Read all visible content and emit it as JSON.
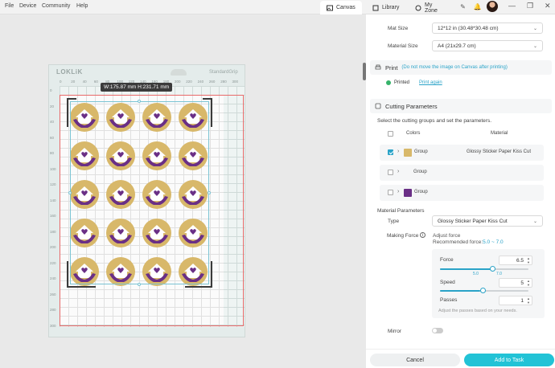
{
  "menu": {
    "file": "File",
    "device": "Device",
    "community": "Community",
    "help": "Help"
  },
  "tabs": {
    "canvas": "Canvas",
    "library": "Library",
    "myzone": "My Zone"
  },
  "mat": {
    "logo": "LOKLiK",
    "grip": "StandardGrip",
    "ruler_top": [
      "0",
      "20",
      "40",
      "60",
      "80",
      "100",
      "120",
      "140",
      "160",
      "180",
      "200",
      "220",
      "240",
      "260",
      "280",
      "300"
    ],
    "ruler_left": [
      "0",
      "20",
      "40",
      "60",
      "80",
      "100",
      "120",
      "140",
      "160",
      "180",
      "200",
      "220",
      "240",
      "260",
      "280",
      "300"
    ],
    "dimension": "W:175.87 mm  H:231.71 mm"
  },
  "panel": {
    "mat_size_label": "Mat Size",
    "mat_size_value": "12*12 in (30.48*30.48 cm)",
    "material_size_label": "Material Size",
    "material_size_value": "A4 (21x29.7 cm)",
    "print_title": "Print",
    "print_note": "(Do not move the image on Canvas after printing)",
    "printed_label": "Printed",
    "print_again": "Print again",
    "cutting_title": "Cutting Parameters",
    "cutting_desc": "Select the cutting groups and set the parameters.",
    "col_colors": "Colors",
    "col_material": "Material",
    "groups": [
      {
        "name": "Group",
        "material": "Glossy Sticker Paper Kiss Cut",
        "color": "#d8b86a",
        "checked": true
      },
      {
        "name": "Group",
        "material": "",
        "color": "",
        "checked": false
      },
      {
        "name": "Group",
        "material": "",
        "color": "#6a2f86",
        "checked": false
      }
    ],
    "material_params": "Material Parameters",
    "type_label": "Type",
    "type_value": "Glossy Sticker Paper Kiss Cut",
    "making_force": "Making Force",
    "adjust_force": "Adjust force",
    "recommended": "Recommended force:",
    "recommended_range": "5.0 ~ 7.0",
    "force_label": "Force",
    "force_value": "6.5",
    "force_min_mark": "5.0",
    "force_max_mark": "7.0",
    "speed_label": "Speed",
    "speed_value": "5",
    "passes_label": "Passes",
    "passes_value": "1",
    "passes_hint": "Adjust the passes based on your needs.",
    "mirror": "Mirror",
    "cancel": "Cancel",
    "add_to_task": "Add to Task"
  },
  "colors": {
    "accent": "#2aa3c8",
    "gold": "#d8b86a",
    "purple": "#6a2f86"
  }
}
